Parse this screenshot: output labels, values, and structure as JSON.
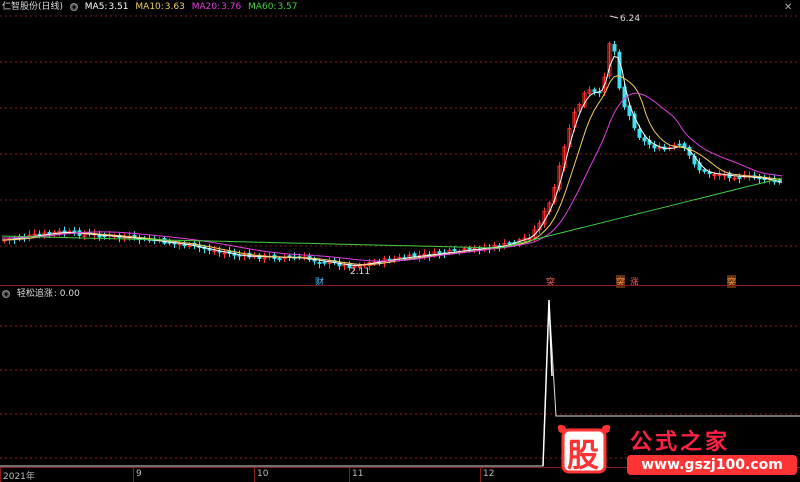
{
  "main_header": {
    "title": "仁智股份(日线)",
    "ma5": {
      "label": "MA5:",
      "value": "3.51",
      "color": "#ffffff"
    },
    "ma10": {
      "label": "MA10:",
      "value": "3.63",
      "color": "#f0d060"
    },
    "ma20": {
      "label": "MA20:",
      "value": "3.76",
      "color": "#e040e0"
    },
    "ma60": {
      "label": "MA60:",
      "value": "3.57",
      "color": "#40d040"
    }
  },
  "sub_header": {
    "title": "轻松追涨",
    "value": ": 0.00"
  },
  "annotations": {
    "high": "6.24",
    "low": "2.11"
  },
  "markers": {
    "cai": "财",
    "tu1": "突",
    "zhang": "涨",
    "tu2": "突"
  },
  "x_axis": [
    "2021年",
    "9",
    "10",
    "11",
    "12"
  ],
  "watermark": {
    "logo": "股",
    "text": "公式之家",
    "url": "www.gszj100.com"
  },
  "colors": {
    "up": "#ff3030",
    "down": "#40e0f0",
    "grid": "#8b1a1a"
  },
  "icons": {
    "close": "close-icon",
    "expand": "chevron-icon"
  }
}
